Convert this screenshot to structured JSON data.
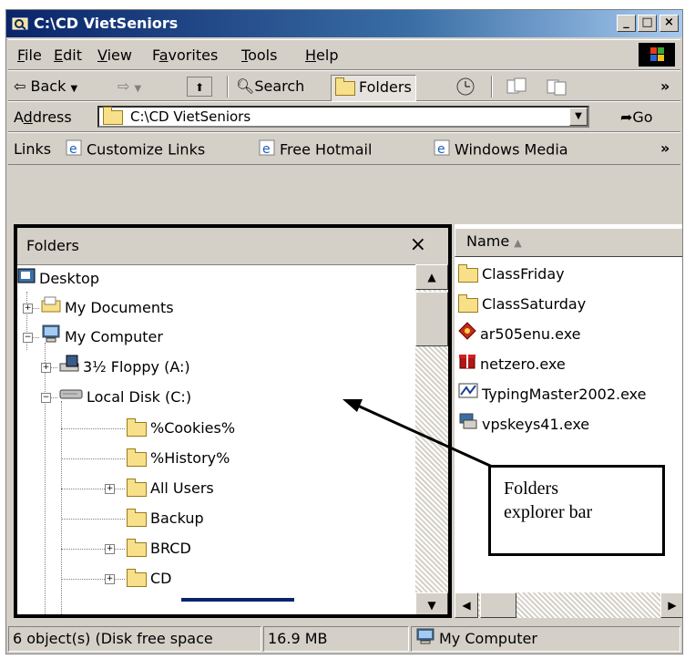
{
  "window": {
    "title": "C:\\CD VietSeniors"
  },
  "titlebar_buttons": [
    "_",
    "□",
    "×"
  ],
  "menu": [
    {
      "label": "File",
      "key": "F",
      "rest": "ile"
    },
    {
      "label": "Edit",
      "key": "E",
      "rest": "dit"
    },
    {
      "label": "View",
      "key": "V",
      "rest": "iew"
    },
    {
      "label": "Favorites",
      "pre": "F",
      "key": "a",
      "rest": "vorites"
    },
    {
      "label": "Tools",
      "key": "T",
      "rest": "ools"
    },
    {
      "label": "Help",
      "key": "H",
      "rest": "elp"
    }
  ],
  "toolbar": {
    "back_label": "Back",
    "search_label": "Search",
    "folders_label": "Folders",
    "more_glyph": "»"
  },
  "address": {
    "label": "Address",
    "label_pre": "A",
    "label_key": "d",
    "label_rest": "dress",
    "value": "C:\\CD VietSeniors",
    "go_label": "Go"
  },
  "links": {
    "label": "Links",
    "items": [
      "Customize Links",
      "Free Hotmail",
      "Windows Media"
    ],
    "more_glyph": "»"
  },
  "folders_pane": {
    "title": "Folders",
    "close_glyph": "×",
    "tree": [
      {
        "label": "Desktop",
        "icon": "desktop-icon",
        "pm": ""
      },
      {
        "label": "My Documents",
        "icon": "my-documents-icon",
        "pm": "+"
      },
      {
        "label": "My Computer",
        "icon": "my-computer-icon",
        "pm": "−"
      },
      {
        "label": "3½ Floppy (A:)",
        "icon": "floppy-drive-icon",
        "pm": "+"
      },
      {
        "label": "Local Disk (C:)",
        "icon": "hard-disk-icon",
        "pm": "−"
      },
      {
        "label": "%Cookies%",
        "icon": "folder-icon",
        "pm": ""
      },
      {
        "label": "%History%",
        "icon": "folder-icon",
        "pm": ""
      },
      {
        "label": "All Users",
        "icon": "folder-icon",
        "pm": "+"
      },
      {
        "label": "Backup",
        "icon": "folder-icon",
        "pm": ""
      },
      {
        "label": "BRCD",
        "icon": "folder-icon",
        "pm": "+"
      },
      {
        "label": "CD",
        "icon": "folder-icon",
        "pm": "+"
      }
    ]
  },
  "file_list": {
    "column_name": "Name",
    "sort_glyph": "▲",
    "items": [
      {
        "name": "ClassFriday",
        "icon": "folder-icon"
      },
      {
        "name": "ClassSaturday",
        "icon": "folder-icon"
      },
      {
        "name": "ar505enu.exe",
        "icon": "acrobat-installer-icon"
      },
      {
        "name": "netzero.exe",
        "icon": "netzero-icon"
      },
      {
        "name": "TypingMaster2002.exe",
        "icon": "typingmaster-icon"
      },
      {
        "name": "vpskeys41.exe",
        "icon": "vpskeys-icon"
      }
    ]
  },
  "callout": {
    "line1": "Folders",
    "line2": "explorer bar"
  },
  "status": {
    "objects": "6 object(s) (Disk free space",
    "free_space": "16.9 MB",
    "zone": "My Computer"
  },
  "colors": {
    "titlebar": "#0a246a",
    "face": "#d4d0c8",
    "folder": "#f8e08a"
  }
}
